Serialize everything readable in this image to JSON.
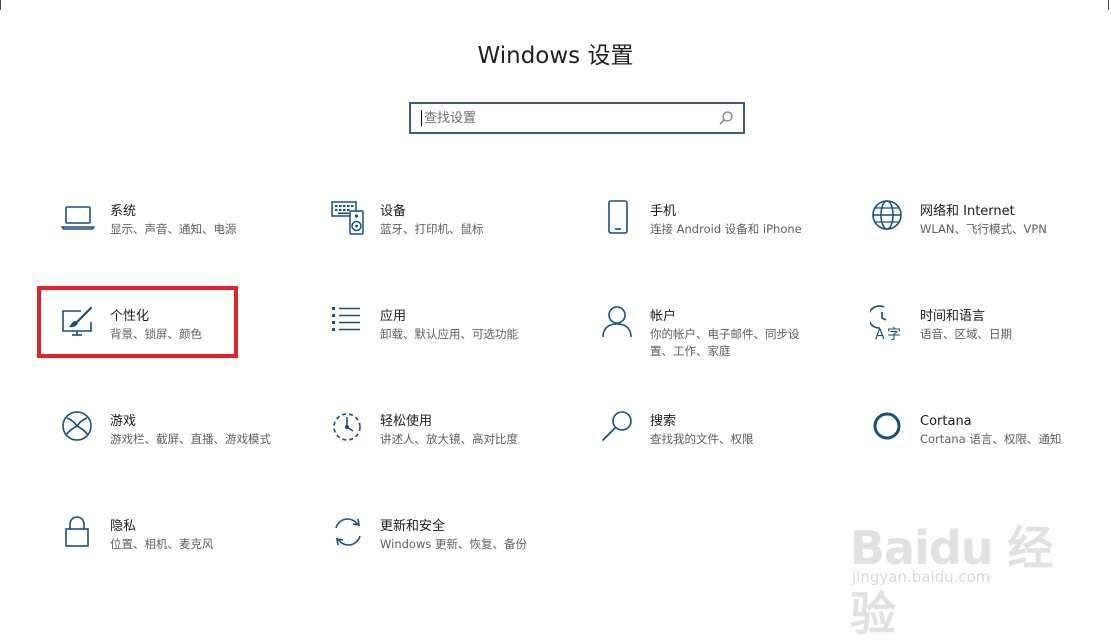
{
  "window": {
    "title": "Windows 设置"
  },
  "search": {
    "placeholder": "查找设置"
  },
  "tiles": [
    {
      "id": "system",
      "title": "系统",
      "desc": "显示、声音、通知、电源",
      "icon": "laptop-icon"
    },
    {
      "id": "devices",
      "title": "设备",
      "desc": "蓝牙、打印机、鼠标",
      "icon": "keyboard-speaker-icon"
    },
    {
      "id": "phone",
      "title": "手机",
      "desc": "连接 Android 设备和 iPhone",
      "icon": "phone-icon"
    },
    {
      "id": "network",
      "title": "网络和 Internet",
      "desc": "WLAN、飞行模式、VPN",
      "icon": "globe-icon"
    },
    {
      "id": "personalization",
      "title": "个性化",
      "desc": "背景、锁屏、颜色",
      "icon": "paintbrush-icon"
    },
    {
      "id": "apps",
      "title": "应用",
      "desc": "卸载、默认应用、可选功能",
      "icon": "list-icon"
    },
    {
      "id": "accounts",
      "title": "帐户",
      "desc": "你的帐户、电子邮件、同步设\n置、工作、家庭",
      "icon": "person-icon"
    },
    {
      "id": "time-language",
      "title": "时间和语言",
      "desc": "语音、区域、日期",
      "icon": "clock-language-icon"
    },
    {
      "id": "gaming",
      "title": "游戏",
      "desc": "游戏栏、截屏、直播、游戏模式",
      "icon": "xbox-icon"
    },
    {
      "id": "ease-of-access",
      "title": "轻松使用",
      "desc": "讲述人、放大镜、高对比度",
      "icon": "ease-of-access-icon"
    },
    {
      "id": "search",
      "title": "搜索",
      "desc": "查找我的文件、权限",
      "icon": "magnifier-icon"
    },
    {
      "id": "cortana",
      "title": "Cortana",
      "desc": "Cortana 语言、权限、通知",
      "icon": "cortana-ring-icon"
    },
    {
      "id": "privacy",
      "title": "隐私",
      "desc": "位置、相机、麦克风",
      "icon": "lock-icon"
    },
    {
      "id": "update-security",
      "title": "更新和安全",
      "desc": "Windows 更新、恢复、备份",
      "icon": "refresh-icon"
    }
  ],
  "colors": {
    "icon_blue": "#1a4f7a",
    "search_border": "#3a5f7f",
    "highlight_red": "#e0242b"
  },
  "watermark": {
    "main": "Baidu 经验",
    "sub": "jingyan.baidu.com"
  }
}
